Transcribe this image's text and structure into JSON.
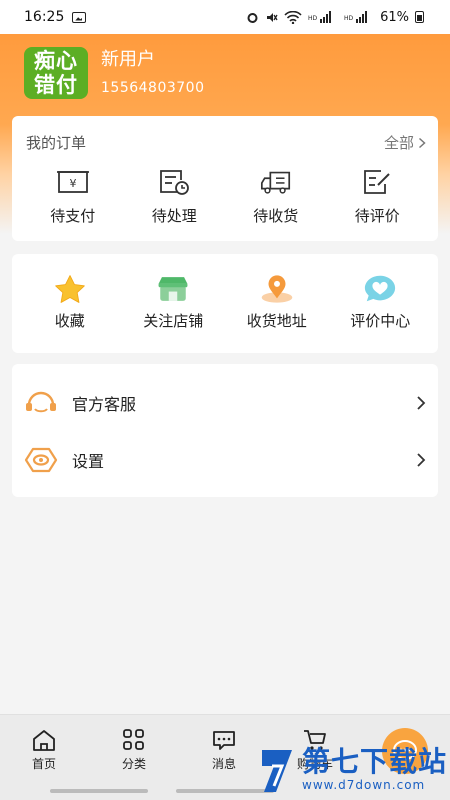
{
  "status_bar": {
    "time": "16:25",
    "battery": "61%"
  },
  "profile": {
    "logo_text": [
      "痴心",
      "错付"
    ],
    "name": "新用户",
    "phone": "15564803700"
  },
  "orders": {
    "title": "我的订单",
    "all_label": "全部",
    "items": [
      {
        "label": "待支付",
        "icon": "pending-payment-icon"
      },
      {
        "label": "待处理",
        "icon": "pending-process-icon"
      },
      {
        "label": "待收货",
        "icon": "delivery-truck-icon"
      },
      {
        "label": "待评价",
        "icon": "review-edit-icon"
      }
    ]
  },
  "shortcuts": {
    "items": [
      {
        "label": "收藏",
        "icon": "star-icon"
      },
      {
        "label": "关注店铺",
        "icon": "store-icon"
      },
      {
        "label": "收货地址",
        "icon": "location-pin-icon"
      },
      {
        "label": "评价中心",
        "icon": "heart-bubble-icon"
      }
    ]
  },
  "menu": {
    "items": [
      {
        "label": "官方客服",
        "icon": "headset-icon"
      },
      {
        "label": "设置",
        "icon": "settings-hex-icon"
      }
    ]
  },
  "tabbar": {
    "items": [
      {
        "label": "首页",
        "icon": "home-icon"
      },
      {
        "label": "分类",
        "icon": "grid-icon"
      },
      {
        "label": "消息",
        "icon": "message-icon"
      },
      {
        "label": "购物车",
        "icon": "cart-icon"
      }
    ]
  },
  "watermark": {
    "title": "第七下载站",
    "url": "www.d7down.com"
  },
  "colors": {
    "accent": "#ff9b3d",
    "logo_green": "#5cae24",
    "watermark_blue": "#1a5fc2"
  }
}
